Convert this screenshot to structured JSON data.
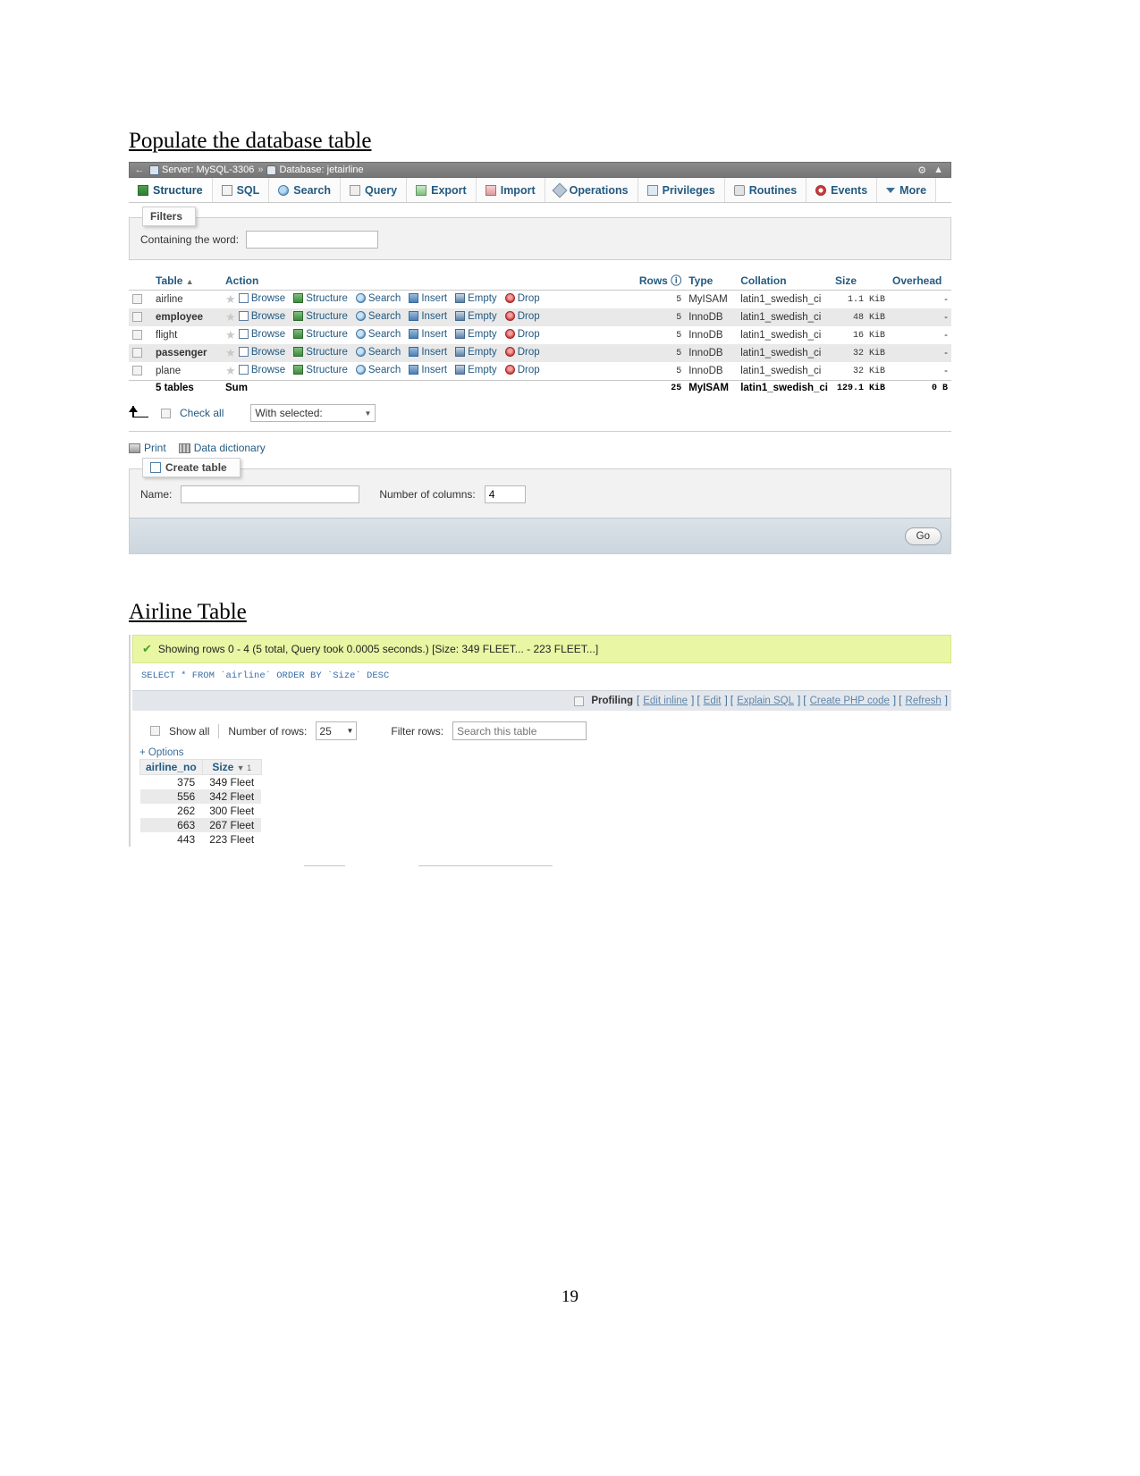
{
  "document": {
    "heading_populate": "Populate the database table ",
    "heading_airline": "Airline Table",
    "page_number": "19"
  },
  "phpmyadmin": {
    "breadcrumb": {
      "back_arrow": "←",
      "server_label": "Server: MySQL-3306",
      "separator": "»",
      "database_label": "Database: jetairline",
      "gear_icon": "gear-icon",
      "collapse_icon": "collapse-icon"
    },
    "tabs": [
      {
        "label": "Structure",
        "icon": "structure-icon",
        "active": true
      },
      {
        "label": "SQL",
        "icon": "sql-icon",
        "active": false
      },
      {
        "label": "Search",
        "icon": "search-icon",
        "active": false
      },
      {
        "label": "Query",
        "icon": "query-icon",
        "active": false
      },
      {
        "label": "Export",
        "icon": "export-icon",
        "active": false
      },
      {
        "label": "Import",
        "icon": "import-icon",
        "active": false
      },
      {
        "label": "Operations",
        "icon": "operations-icon",
        "active": false
      },
      {
        "label": "Privileges",
        "icon": "privileges-icon",
        "active": false
      },
      {
        "label": "Routines",
        "icon": "routines-icon",
        "active": false
      },
      {
        "label": "Events",
        "icon": "events-icon",
        "active": false
      },
      {
        "label": "More",
        "icon": "chevron-down-icon",
        "active": false
      }
    ],
    "filters": {
      "legend": "Filters",
      "containing_label": "Containing the word:",
      "containing_value": "",
      "containing_placeholder": ""
    },
    "table_list": {
      "headers": [
        "",
        "Table",
        "Action",
        "Rows",
        "Type",
        "Collation",
        "Size",
        "Overhead"
      ],
      "rows_help_icon": "help-icon",
      "actions": [
        "Browse",
        "Structure",
        "Search",
        "Insert",
        "Empty",
        "Drop"
      ],
      "rows": [
        {
          "name": "airline",
          "rows": "5",
          "type": "MyISAM",
          "collation": "latin1_swedish_ci",
          "size": "1.1 KiB",
          "overhead": "-"
        },
        {
          "name": "employee",
          "rows": "5",
          "type": "InnoDB",
          "collation": "latin1_swedish_ci",
          "size": "48 KiB",
          "overhead": "-"
        },
        {
          "name": "flight",
          "rows": "5",
          "type": "InnoDB",
          "collation": "latin1_swedish_ci",
          "size": "16 KiB",
          "overhead": "-"
        },
        {
          "name": "passenger",
          "rows": "5",
          "type": "InnoDB",
          "collation": "latin1_swedish_ci",
          "size": "32 KiB",
          "overhead": "-"
        },
        {
          "name": "plane",
          "rows": "5",
          "type": "InnoDB",
          "collation": "latin1_swedish_ci",
          "size": "32 KiB",
          "overhead": "-"
        }
      ],
      "summary": {
        "count_label": "5 tables",
        "sum_label": "Sum",
        "rows": "25",
        "type": "MyISAM",
        "collation": "latin1_swedish_ci",
        "size": "129.1 KiB",
        "overhead": "0 B"
      }
    },
    "with_selected": {
      "check_all_label": "Check all",
      "select_value": "With selected:"
    },
    "footer_links": {
      "print": "Print",
      "data_dictionary": "Data dictionary"
    },
    "create_table": {
      "legend": "Create table",
      "name_label": "Name:",
      "name_value": "",
      "columns_label": "Number of columns:",
      "columns_value": "4",
      "go_label": "Go"
    }
  },
  "result_panel": {
    "status": "Showing rows 0 - 4 (5 total, Query took 0.0005 seconds.) [Size: 349 FLEET... - 223 FLEET...]",
    "sql": "SELECT * FROM `airline` ORDER BY `Size` DESC",
    "toolbar": {
      "profiling_label": "Profiling",
      "links": [
        "Edit inline",
        "Edit",
        "Explain SQL",
        "Create PHP code",
        "Refresh"
      ]
    },
    "rows_bar": {
      "show_all_label": "Show all",
      "number_of_rows_label": "Number of rows:",
      "number_of_rows_value": "25",
      "filter_rows_label": "Filter rows:",
      "filter_rows_placeholder": "Search this table",
      "filter_rows_value": ""
    },
    "options_label": "+ Options",
    "table": {
      "headers": [
        "airline_no",
        "Size"
      ],
      "sort_indicator": "▼ 1",
      "rows": [
        {
          "airline_no": "375",
          "size": "349 Fleet"
        },
        {
          "airline_no": "556",
          "size": "342 Fleet"
        },
        {
          "airline_no": "262",
          "size": "300 Fleet"
        },
        {
          "airline_no": "663",
          "size": "267 Fleet"
        },
        {
          "airline_no": "443",
          "size": "223 Fleet"
        }
      ]
    }
  },
  "colors": {
    "accent_link": "#235a81",
    "success_bg": "#e9f7a4",
    "toolbar_bg": "#e3e7ec",
    "breadcrumb_bg": "#7e7e7e"
  }
}
